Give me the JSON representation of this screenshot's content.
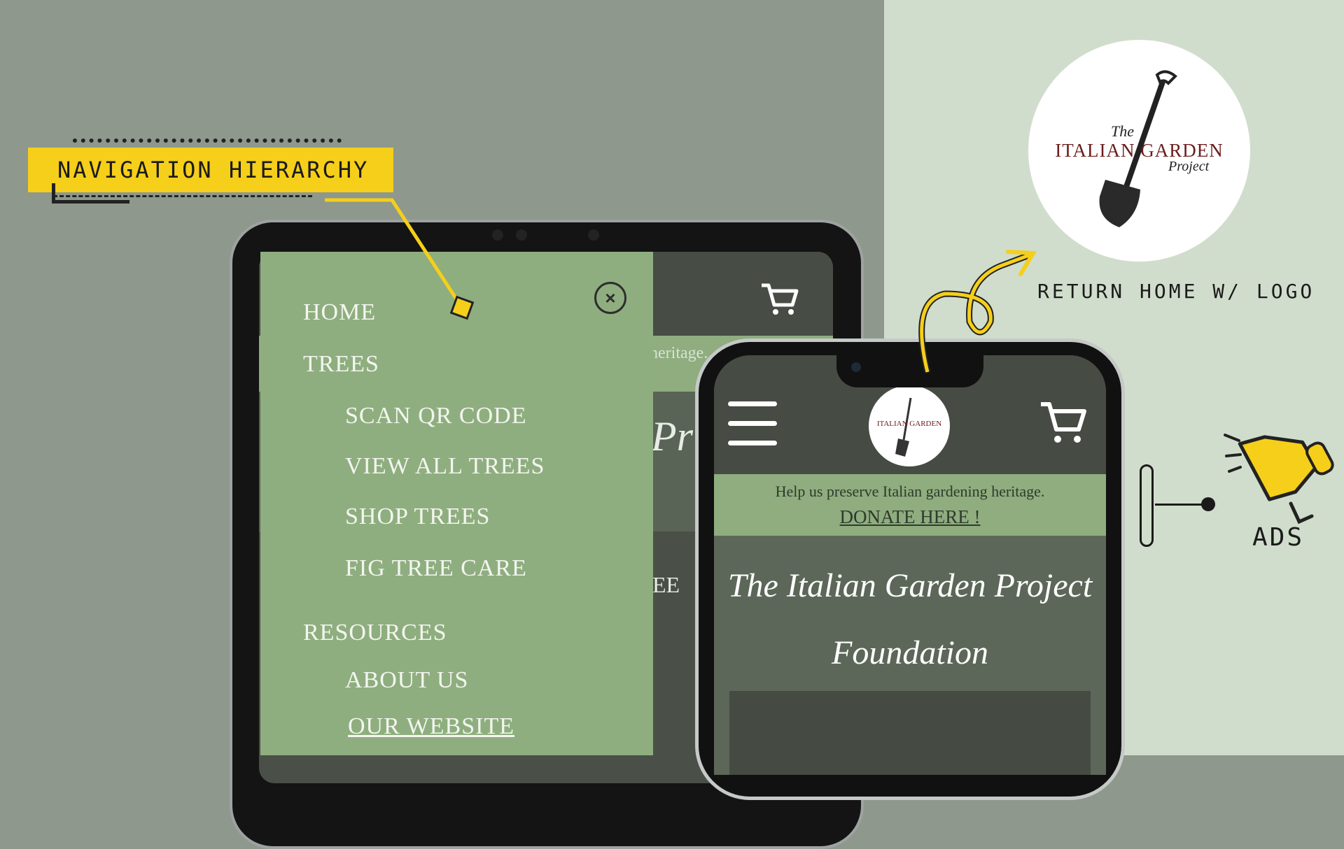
{
  "annotation": {
    "nav_hierarchy": "NAVIGATION HIERARCHY",
    "return_home": "RETURN HOME W/ LOGO",
    "ads": "ADS"
  },
  "menu": {
    "items": [
      {
        "label": "HOME"
      },
      {
        "label": "TREES"
      },
      {
        "label": "SCAN QR CODE"
      },
      {
        "label": "VIEW ALL TREES"
      },
      {
        "label": "SHOP TREES"
      },
      {
        "label": "FIG TREE CARE"
      },
      {
        "label": "RESOURCES"
      },
      {
        "label": "ABOUT US"
      },
      {
        "label": "OUR WEBSITE"
      }
    ],
    "close_symbol": "×"
  },
  "tablet": {
    "heritage_fragment": "heritage.",
    "script_fragment": "Pr",
    "text_fragment": "EE"
  },
  "phone": {
    "banner_text": "Help us preserve Italian gardening heritage.",
    "donate_link": "DONATE HERE !",
    "title_line1": "The Italian Garden Project",
    "title_line2": "Foundation"
  },
  "logo": {
    "the": "The",
    "name": "ITALIAN GARDEN",
    "project": "Project"
  },
  "colors": {
    "accent": "#f5cf1a",
    "menu_green": "#8fae7f",
    "dark_header": "#464b44",
    "logo_red": "#6b1c1c"
  },
  "icons": [
    "cart-icon",
    "hamburger-menu-icon",
    "close-icon",
    "megaphone-icon",
    "shovel-icon"
  ]
}
